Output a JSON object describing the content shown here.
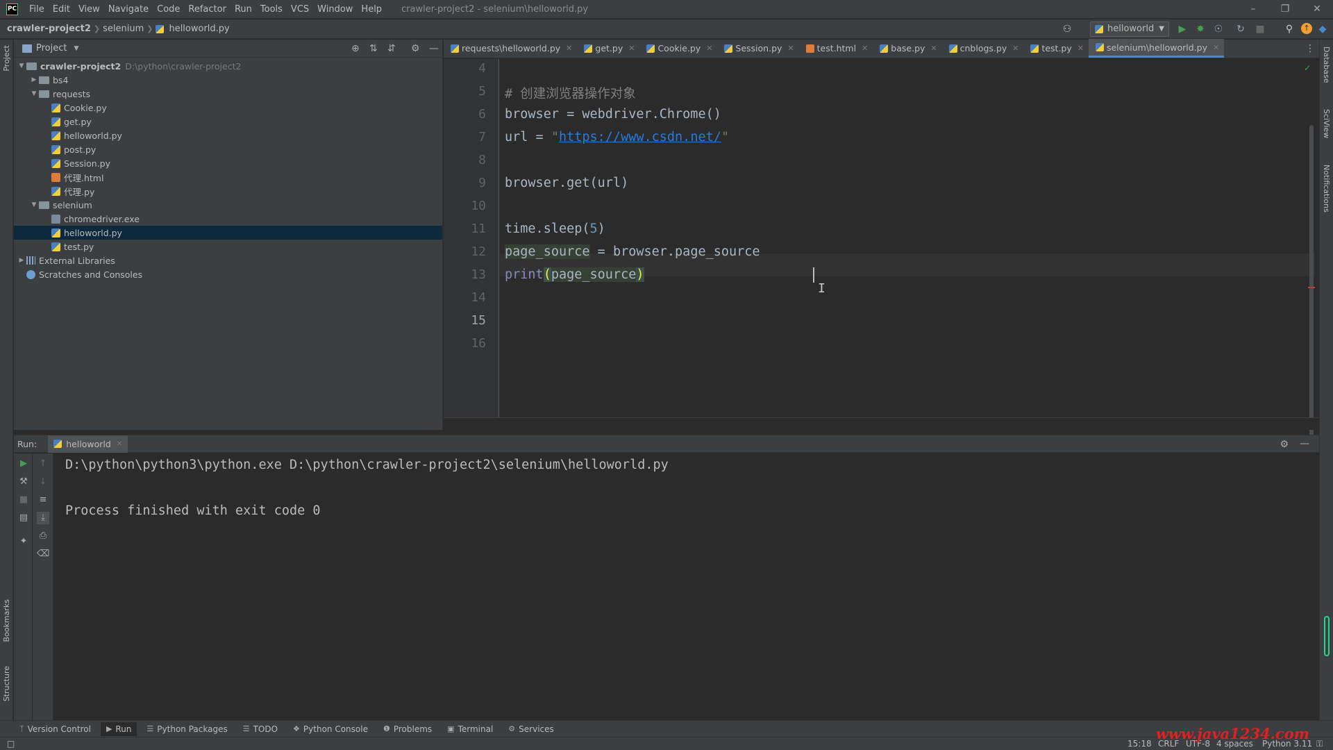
{
  "menubar": {
    "logo": "PC",
    "items": [
      "File",
      "Edit",
      "View",
      "Navigate",
      "Code",
      "Refactor",
      "Run",
      "Tools",
      "VCS",
      "Window",
      "Help"
    ],
    "window_title": "crawler-project2 - selenium\\helloworld.py"
  },
  "navbar": {
    "crumbs": [
      "crawler-project2",
      "selenium",
      "helloworld.py"
    ],
    "run_config": "helloworld"
  },
  "left_stripe": {
    "project": "Project",
    "bookmarks": "Bookmarks",
    "structure": "Structure"
  },
  "right_stripe": {
    "database": "Database",
    "sciview": "SciView",
    "notifications": "Notifications"
  },
  "project_panel": {
    "title": "Project",
    "tree": [
      {
        "label": "crawler-project2",
        "path": "D:\\python\\crawler-project2",
        "type": "folder",
        "depth": 0,
        "expanded": true
      },
      {
        "label": "bs4",
        "type": "folder",
        "depth": 1,
        "expanded": false
      },
      {
        "label": "requests",
        "type": "folder",
        "depth": 1,
        "expanded": true
      },
      {
        "label": "Cookie.py",
        "type": "py",
        "depth": 2
      },
      {
        "label": "get.py",
        "type": "py",
        "depth": 2
      },
      {
        "label": "helloworld.py",
        "type": "py",
        "depth": 2
      },
      {
        "label": "post.py",
        "type": "py",
        "depth": 2
      },
      {
        "label": "Session.py",
        "type": "py",
        "depth": 2
      },
      {
        "label": "代理.html",
        "type": "html",
        "depth": 2
      },
      {
        "label": "代理.py",
        "type": "py",
        "depth": 2
      },
      {
        "label": "selenium",
        "type": "folder",
        "depth": 1,
        "expanded": true
      },
      {
        "label": "chromedriver.exe",
        "type": "exe",
        "depth": 2
      },
      {
        "label": "helloworld.py",
        "type": "py",
        "depth": 2,
        "selected": true
      },
      {
        "label": "test.py",
        "type": "py",
        "depth": 2
      },
      {
        "label": "External Libraries",
        "type": "lib",
        "depth": 0,
        "expanded": false
      },
      {
        "label": "Scratches and Consoles",
        "type": "scr",
        "depth": 0
      }
    ]
  },
  "tabs": [
    {
      "label": "requests\\helloworld.py",
      "type": "py"
    },
    {
      "label": "get.py",
      "type": "py"
    },
    {
      "label": "Cookie.py",
      "type": "py"
    },
    {
      "label": "Session.py",
      "type": "py"
    },
    {
      "label": "test.html",
      "type": "html"
    },
    {
      "label": "base.py",
      "type": "py"
    },
    {
      "label": "cnblogs.py",
      "type": "py"
    },
    {
      "label": "test.py",
      "type": "py"
    },
    {
      "label": "selenium\\helloworld.py",
      "type": "py",
      "active": true
    }
  ],
  "editor": {
    "line_numbers": [
      "4",
      "5",
      "6",
      "7",
      "8",
      "9",
      "10",
      "11",
      "12",
      "13",
      "14",
      "15",
      "16"
    ],
    "current_line": "15",
    "code": {
      "l5": "# 创建浏览器操作对象",
      "l6": "browser = webdriver.Chrome()",
      "l8_a": "url = ",
      "l8_q1": "\"",
      "l8_url": "https://www.csdn.net/",
      "l8_q2": "\"",
      "l10": "browser.get(url)",
      "l12_a": "time.sleep(",
      "l12_n": "5",
      "l12_b": ")",
      "l14_a": "page_source",
      "l14_b": " = browser.page_source",
      "l15_a": "print",
      "l15_b": "(",
      "l15_c": "page_source",
      "l15_d": ")"
    }
  },
  "run_panel": {
    "label": "Run:",
    "tab": "helloworld",
    "lines": [
      "D:\\python\\python3\\python.exe D:\\python\\crawler-project2\\selenium\\helloworld.py",
      "",
      "Process finished with exit code 0"
    ]
  },
  "bottom_tools": [
    "Version Control",
    "Run",
    "Python Packages",
    "TODO",
    "Python Console",
    "Problems",
    "Terminal",
    "Services"
  ],
  "status": {
    "position": "15:18",
    "line_sep": "CRLF",
    "encoding": "UTF-8",
    "indent": "4 spaces",
    "interpreter": "Python 3.11"
  },
  "watermark": "www.java1234.com",
  "colors": {
    "selection": "#0d293e",
    "accent": "#4a88c7",
    "run_green": "#499c54"
  }
}
